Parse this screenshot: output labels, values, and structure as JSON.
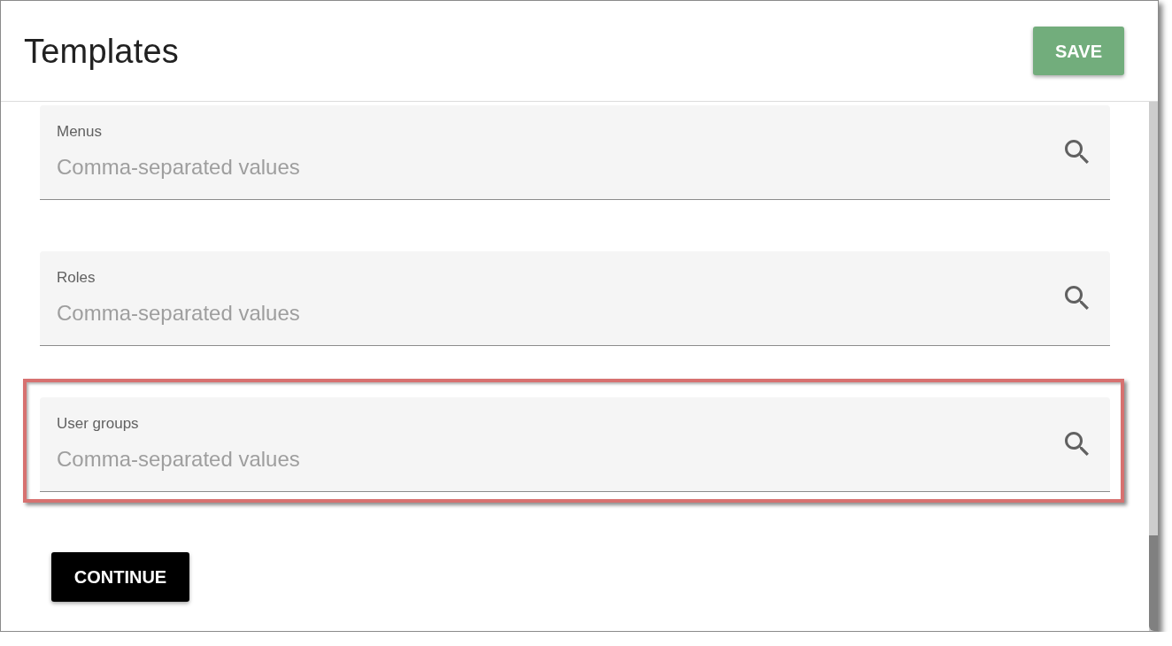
{
  "dialog": {
    "title": "Templates",
    "save_button": "SAVE"
  },
  "fields": [
    {
      "label": "Menus",
      "placeholder": "Comma-separated values",
      "highlighted": false
    },
    {
      "label": "Roles",
      "placeholder": "Comma-separated values",
      "highlighted": false
    },
    {
      "label": "User groups",
      "placeholder": "Comma-separated values",
      "highlighted": true
    }
  ],
  "continue_button": "CONTINUE"
}
